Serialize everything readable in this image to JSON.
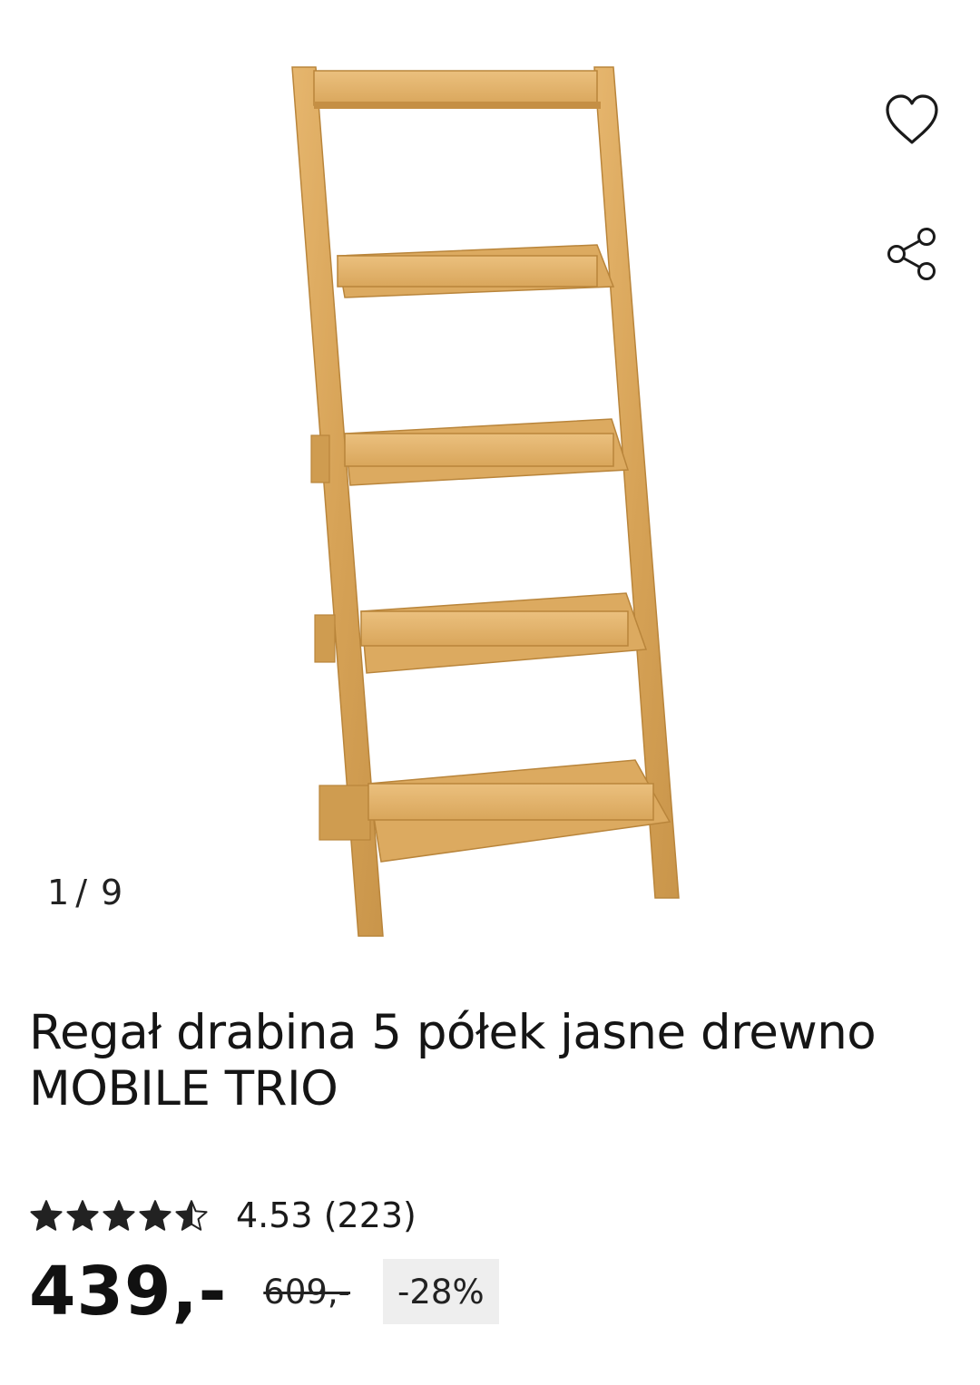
{
  "gallery": {
    "current_index": "1",
    "separator": "/",
    "total": "9",
    "image_alt": "Regał drabina 5 półek jasne drewno MOBILE TRIO"
  },
  "actions": {
    "favorite_icon": "heart-outline-icon",
    "share_icon": "share-icon"
  },
  "product": {
    "title": "Regał drabina 5 półek jasne drewno MOBILE TRIO",
    "rating_value": 4.53,
    "rating_text": "4.53 (223)",
    "stars_total": 5,
    "price": "439,-",
    "old_price": "609,-",
    "discount": "-28%"
  },
  "colors": {
    "wood_light": "#e2b067",
    "wood_mid": "#d4a154",
    "wood_dark": "#b9853b",
    "text": "#111111",
    "badge_bg": "#eeeeee"
  }
}
